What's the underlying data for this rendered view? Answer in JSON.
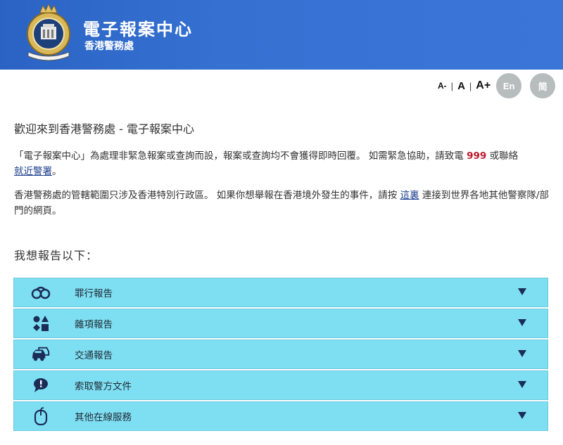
{
  "header": {
    "title": "電子報案中心",
    "subtitle": "香港警務處"
  },
  "controls": {
    "font_small": "A-",
    "font_normal": "A",
    "font_large": "A+",
    "separator": "|",
    "lang_en": "En",
    "lang_sc": "简"
  },
  "main": {
    "welcome": "歡迎來到香港警務處 - 電子報案中心",
    "p1_part1": "「電子報案中心」為處理非緊急報案或查詢而設，報案或查詢均不會獲得即時回覆。 如需緊急協助，請致電 ",
    "p1_emergency": "999",
    "p1_part2": " 或聯絡",
    "p1_link": "就近警署",
    "p1_end": "。",
    "p2_part1": "香港警務處的管轄範圍只涉及香港特別行政區。 如果你想舉報在香港境外發生的事件，請按 ",
    "p2_link": "這裏",
    "p2_part2": " 連接到世界各地其他警察隊/部門的網頁。",
    "report_heading": "我想報告以下："
  },
  "menu": {
    "items": [
      {
        "label": "罪行報告",
        "icon": "handcuffs-icon"
      },
      {
        "label": "雜項報告",
        "icon": "shapes-icon"
      },
      {
        "label": "交通報告",
        "icon": "cars-icon"
      },
      {
        "label": "索取警方文件",
        "icon": "speech-bubble-icon"
      },
      {
        "label": "其他在線服務",
        "icon": "mouse-icon"
      }
    ]
  },
  "colors": {
    "header_bg": "#3671d2",
    "menu_bg": "#7fdff2",
    "emergency": "#c0182c",
    "link": "#1c3f8e",
    "lang_button": "#b7bcbd"
  }
}
